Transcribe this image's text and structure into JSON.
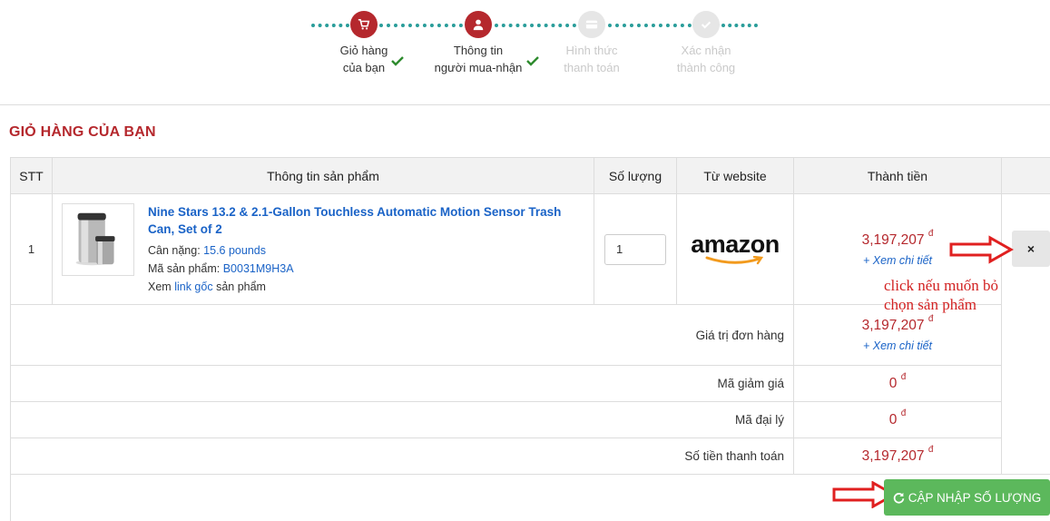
{
  "steps": [
    {
      "line1": "Giỏ hàng",
      "line2": "của bạn",
      "icon": "cart-icon",
      "state": "done"
    },
    {
      "line1": "Thông tin",
      "line2": "người mua-nhận",
      "icon": "user-icon",
      "state": "done"
    },
    {
      "line1": "Hình thức",
      "line2": "thanh toán",
      "icon": "card-icon",
      "state": "pending"
    },
    {
      "line1": "Xác nhận",
      "line2": "thành công",
      "icon": "check-icon",
      "state": "pending"
    }
  ],
  "cart": {
    "title": "GIỎ HÀNG CỦA BẠN",
    "headers": {
      "stt": "STT",
      "product": "Thông tin sản phẩm",
      "qty": "Số lượng",
      "website": "Từ website",
      "total": "Thành tiền"
    },
    "item": {
      "stt": "1",
      "name": "Nine Stars 13.2 & 2.1-Gallon Touchless Automatic Motion Sensor Trash Can, Set of 2",
      "weight_label": "Cân nặng:",
      "weight_value": "15.6 pounds",
      "sku_label": "Mã sản phẩm:",
      "sku_value": "B0031M9H3A",
      "link_prefix": "Xem",
      "link_text": "link gốc",
      "link_suffix": "sản phẩm",
      "qty": "1",
      "website": "amazon",
      "price": "3,197,207",
      "currency": "đ",
      "detail_link": "+ Xem chi tiết"
    },
    "remove_label": "×",
    "summary": {
      "order_value_label": "Giá trị đơn hàng",
      "order_value": "3,197,207",
      "order_detail_link": "+ Xem chi tiết",
      "discount_label": "Mã giảm giá",
      "discount_value": "0",
      "agent_label": "Mã đại lý",
      "agent_value": "0",
      "payment_label": "Số tiền thanh toán",
      "payment_value": "3,197,207",
      "currency": "đ"
    },
    "update_button": "CẬP NHẬP SỐ LƯỢNG"
  },
  "annotation": {
    "line1": "click nếu muốn bỏ",
    "line2": "chọn sản phẩm"
  },
  "colors": {
    "brand": "#b5282d",
    "step_dots": "#2a9d9a",
    "link": "#1a63c7",
    "success": "#5cb85c",
    "annotation": "#d22222"
  }
}
